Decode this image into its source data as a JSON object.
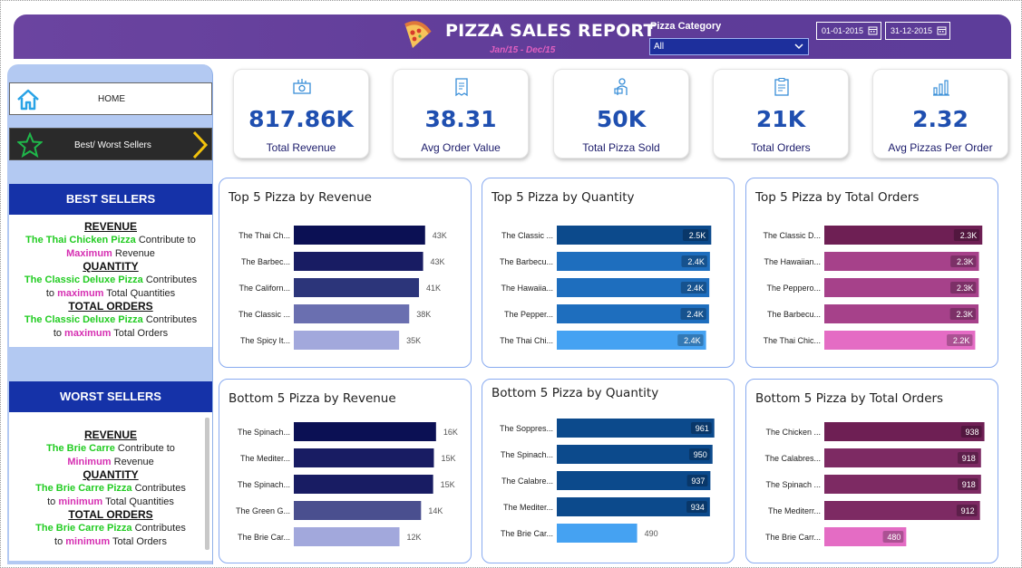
{
  "header": {
    "title": "PIZZA SALES REPORT",
    "subtitle": "Jan/15 - Dec/15",
    "category_label": "Pizza Category",
    "category_value": "All",
    "date_from": "01-01-2015",
    "date_to": "31-12-2015"
  },
  "nav": {
    "home_label": "HOME",
    "best_worst_label": "Best/ Worst Sellers"
  },
  "best": {
    "heading": "BEST SELLERS",
    "rev_title": "REVENUE",
    "rev_pizza": "The Thai Chicken  Pizza",
    "rev_text1": " Contribute to",
    "rev_word": "Maximum",
    "rev_text2": " Revenue",
    "qty_title": "QUANTITY",
    "qty_pizza": "The Classic Deluxe Pizza",
    "qty_text1": " Contributes",
    "qty_pre": "to ",
    "qty_word": "maximum",
    "qty_text2": " Total Quantities",
    "ord_title": "TOTAL ORDERS",
    "ord_pizza": "The Classic Deluxe Pizza",
    "ord_text1": " Contributes",
    "ord_pre": "to ",
    "ord_word": "maximum",
    "ord_text2": " Total Orders"
  },
  "worst": {
    "heading": "WORST SELLERS",
    "rev_title": "REVENUE",
    "rev_pizza": "The Brie Carre",
    "rev_text1": " Contribute to",
    "rev_word": "Minimum",
    "rev_text2": " Revenue",
    "qty_title": "QUANTITY",
    "qty_pizza": "The Brie Carre Pizza",
    "qty_text1": " Contributes",
    "qty_pre": "to ",
    "qty_word": "minimum",
    "qty_text2": " Total Quantities",
    "ord_title": "TOTAL ORDERS",
    "ord_pizza": "The Brie Carre Pizza",
    "ord_text1": " Contributes",
    "ord_pre": "to ",
    "ord_word": "minimum",
    "ord_text2": " Total Orders"
  },
  "kpis": [
    {
      "value": "817.86K",
      "label": "Total Revenue",
      "icon": "money-icon"
    },
    {
      "value": "38.31",
      "label": "Avg Order Value",
      "icon": "receipt-icon"
    },
    {
      "value": "50K",
      "label": "Total Pizza Sold",
      "icon": "delivery-icon"
    },
    {
      "value": "21K",
      "label": "Total Orders",
      "icon": "clipboard-icon"
    },
    {
      "value": "2.32",
      "label": "Avg Pizzas Per Order",
      "icon": "chart-icon"
    }
  ],
  "colors": {
    "header_bg": "#5f3c98",
    "kpi_value": "#1f4fb0",
    "best_green": "#22cc22",
    "highlight_pink": "#d62fb2",
    "section_blue": "#1532a8"
  },
  "chart_data": [
    {
      "type": "bar",
      "orientation": "horizontal",
      "title": "Top 5 Pizza by Revenue",
      "categories": [
        "The Thai Ch...",
        "The Barbec...",
        "The Californ...",
        "The Classic ...",
        "The Spicy It..."
      ],
      "values": [
        43434.25,
        42768.0,
        41409.5,
        38180.5,
        34831.25
      ],
      "labels": [
        "43K",
        "43K",
        "41K",
        "38K",
        "35K"
      ],
      "label_position": "outside",
      "colors": [
        "#0b1054",
        "#181c63",
        "#2c357a",
        "#6a6fb0",
        "#a2a8dc"
      ],
      "xlim": [
        0,
        48000
      ]
    },
    {
      "type": "bar",
      "orientation": "horizontal",
      "title": "Top 5 Pizza by Quantity",
      "categories": [
        "The Classic ...",
        "The Barbecu...",
        "The Hawaiia...",
        "The Pepper...",
        "The Thai Chi..."
      ],
      "values": [
        2453,
        2432,
        2422,
        2418,
        2371
      ],
      "labels": [
        "2.5K",
        "2.4K",
        "2.4K",
        "2.4K",
        "2.4K"
      ],
      "label_position": "inside",
      "colors": [
        "#0c4a8c",
        "#1e6ebe",
        "#1e6ebe",
        "#1e6ebe",
        "#45a2f2"
      ],
      "xlim": [
        0,
        2650
      ]
    },
    {
      "type": "bar",
      "orientation": "horizontal",
      "title": "Top 5 Pizza by Total Orders",
      "categories": [
        "The Classic D...",
        "The Hawaiian...",
        "The Peppero...",
        "The Barbecu...",
        "The Thai Chic..."
      ],
      "values": [
        2329,
        2280,
        2278,
        2273,
        2225
      ],
      "labels": [
        "2.3K",
        "2.3K",
        "2.3K",
        "2.3K",
        "2.2K"
      ],
      "label_position": "inside",
      "colors": [
        "#6e1f54",
        "#a6418a",
        "#a6418a",
        "#a6418a",
        "#e46cc4"
      ],
      "xlim": [
        0,
        2540
      ]
    },
    {
      "type": "bar",
      "orientation": "horizontal",
      "title": "Bottom 5 Pizza by Revenue",
      "categories": [
        "The Spinach...",
        "The Mediter...",
        "The Spinach...",
        "The Green G...",
        "The Brie Car..."
      ],
      "values": [
        15596,
        15360.5,
        15277.75,
        13955.75,
        11588.5
      ],
      "labels": [
        "16K",
        "15K",
        "15K",
        "14K",
        "12K"
      ],
      "label_position": "outside",
      "colors": [
        "#0b1054",
        "#181c63",
        "#181c63",
        "#4a4f8f",
        "#a2a8dc"
      ],
      "xlim": [
        0,
        18200
      ]
    },
    {
      "type": "bar",
      "orientation": "horizontal",
      "title": "Bottom 5 Pizza by Quantity",
      "categories": [
        "The Soppres...",
        "The Spinach...",
        "The Calabre...",
        "The Mediter...",
        "The Brie Car..."
      ],
      "values": [
        961,
        950,
        937,
        934,
        490
      ],
      "labels": [
        "961",
        "950",
        "937",
        "934",
        "490"
      ],
      "label_position": "inside_except_last",
      "colors": [
        "#0c4a8c",
        "#0c4a8c",
        "#0c4a8c",
        "#0c4a8c",
        "#45a2f2"
      ],
      "xlim": [
        0,
        1040
      ]
    },
    {
      "type": "bar",
      "orientation": "horizontal",
      "title": "Bottom 5 Pizza by Total Orders",
      "categories": [
        "The Chicken ...",
        "The Calabres...",
        "The Spinach ...",
        "The Mediterr...",
        "The Brie Carr..."
      ],
      "values": [
        938,
        918,
        918,
        912,
        480
      ],
      "labels": [
        "938",
        "918",
        "918",
        "912",
        "480"
      ],
      "label_position": "inside",
      "colors": [
        "#6e1f54",
        "#7d2a63",
        "#7d2a63",
        "#7d2a63",
        "#e46cc4"
      ],
      "xlim": [
        0,
        1020
      ]
    }
  ]
}
